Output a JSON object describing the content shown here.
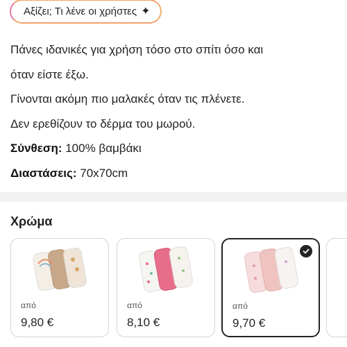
{
  "ai_summary": {
    "label": "Αξίζει; Τι λένε οι χρήστες",
    "icon": "sparkle-icon"
  },
  "description": {
    "lines": [
      "Πάνες ιδανικές για χρήση τόσο στο σπίτι όσο και",
      "όταν είστε έξω.",
      "Γίνονται ακόμη πιο μαλακές όταν τις πλένετε.",
      "Δεν ερεθίζουν το δέρμα του μωρού."
    ],
    "composition_label": "Σύνθεση:",
    "composition_value": " 100% βαμβάκι",
    "dimensions_label": "Διαστάσεις:",
    "dimensions_value": " 70x70cm"
  },
  "colors": {
    "title": "Χρώμα",
    "options": [
      {
        "from": "από",
        "price": "9,80 €",
        "selected": false,
        "swatches": [
          "#f4efe6",
          "#c8a88a",
          "#efe4d6"
        ]
      },
      {
        "from": "από",
        "price": "8,10 €",
        "selected": false,
        "swatches": [
          "#f5f5f2",
          "#e86d8a",
          "#f6f3ee"
        ]
      },
      {
        "from": "από",
        "price": "9,70 €",
        "selected": true,
        "swatches": [
          "#f6dcdc",
          "#efc4c0",
          "#f7f3f0"
        ]
      }
    ]
  }
}
